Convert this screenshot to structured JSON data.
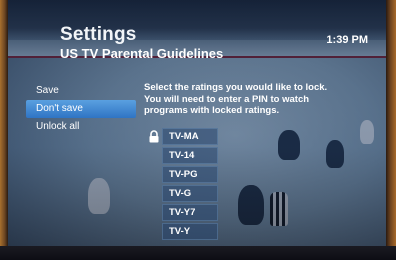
{
  "header": {
    "title": "Settings",
    "subtitle": "US TV Parental Guidelines",
    "clock": "1:39 PM"
  },
  "menu": {
    "items": [
      {
        "label": "Save",
        "selected": false
      },
      {
        "label": "Don't save",
        "selected": true
      },
      {
        "label": "Unlock all",
        "selected": false
      }
    ]
  },
  "instructions": {
    "lines": [
      "Select the ratings you would like to lock.",
      "You will need to enter a PIN to watch",
      "programs with locked ratings."
    ]
  },
  "ratings": [
    {
      "label": "TV-MA",
      "locked": true
    },
    {
      "label": "TV-14",
      "locked": false
    },
    {
      "label": "TV-PG",
      "locked": false
    },
    {
      "label": "TV-G",
      "locked": false
    },
    {
      "label": "TV-Y7",
      "locked": false
    },
    {
      "label": "TV-Y",
      "locked": false
    }
  ],
  "colors": {
    "selection": "#3f86d2",
    "rating_box": "#2c4c76"
  }
}
